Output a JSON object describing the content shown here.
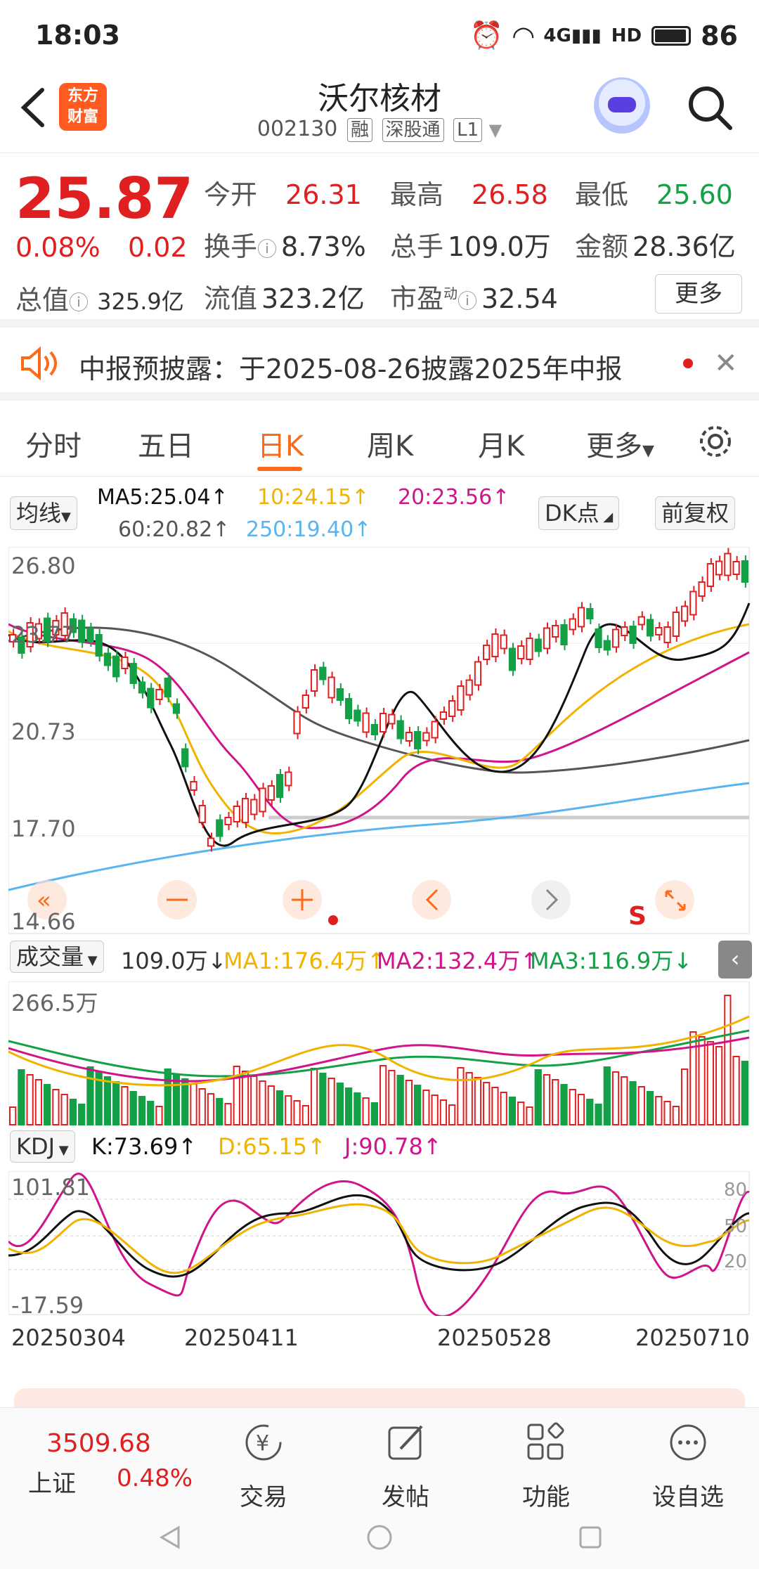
{
  "status": {
    "time": "18:03",
    "battery": "86"
  },
  "header": {
    "title": "沃尔核材",
    "code": "002130",
    "tags": [
      "融",
      "深股通",
      "L1"
    ],
    "logo_text": [
      "东方",
      "财富"
    ]
  },
  "quote": {
    "price": "25.87",
    "change_pct": "0.08%",
    "change_amt": "0.02",
    "total_value_label": "总值",
    "total_value": "325.9亿",
    "open_label": "今开",
    "open": "26.31",
    "high_label": "最高",
    "high": "26.58",
    "low_label": "最低",
    "low": "25.60",
    "turnover_label": "换手",
    "turnover": "8.73%",
    "volume_label": "总手",
    "volume": "109.0万",
    "amount_label": "金额",
    "amount": "28.36亿",
    "float_label": "流值",
    "float_value": "323.2亿",
    "pe_label": "市盈",
    "pe_sup": "动",
    "pe": "32.54",
    "more_label": "更多"
  },
  "notice": {
    "text": "中报预披露：于2025-08-26披露2025年中报"
  },
  "tabs": [
    "分时",
    "五日",
    "日K",
    "周K",
    "月K",
    "更多"
  ],
  "active_tab": "日K",
  "ma": {
    "selector": "均线",
    "ma5": "MA5:25.04↑",
    "ma10": "10:24.15↑",
    "ma20": "20:23.56↑",
    "ma60": "60:20.82↑",
    "ma250": "250:19.40↑",
    "dk": "DK点",
    "fq": "前复权"
  },
  "kline_axis": [
    "26.80",
    "23.77",
    "20.73",
    "17.70",
    "14.66"
  ],
  "kline_marker": "S",
  "volume_row": {
    "selector": "成交量",
    "value": "109.0万↓",
    "ma1": "MA1:176.4万↑",
    "ma2": "MA2:132.4万↑",
    "ma3": "MA3:116.9万↓",
    "axis_top": "266.5万"
  },
  "kdj_row": {
    "selector": "KDJ",
    "k": "K:73.69↑",
    "d": "D:65.15↑",
    "j": "J:90.78↑",
    "axis_top": "101.81",
    "axis_bottom": "-17.59",
    "levels": [
      "80",
      "50",
      "20"
    ]
  },
  "dates": [
    "20250304",
    "20250411",
    "20250528",
    "20250710"
  ],
  "bottom": {
    "index_value": "3509.68",
    "index_name": "上证",
    "index_pct": "0.48%",
    "nav": [
      "交易",
      "发帖",
      "功能",
      "设自选"
    ]
  },
  "colors": {
    "up": "#e02020",
    "down": "#13a046",
    "accent": "#ff6a1a",
    "ma5": "#111111",
    "ma10": "#f0b400",
    "ma20": "#d0158a",
    "ma60": "#555555",
    "ma250": "#5ab4f0"
  }
}
